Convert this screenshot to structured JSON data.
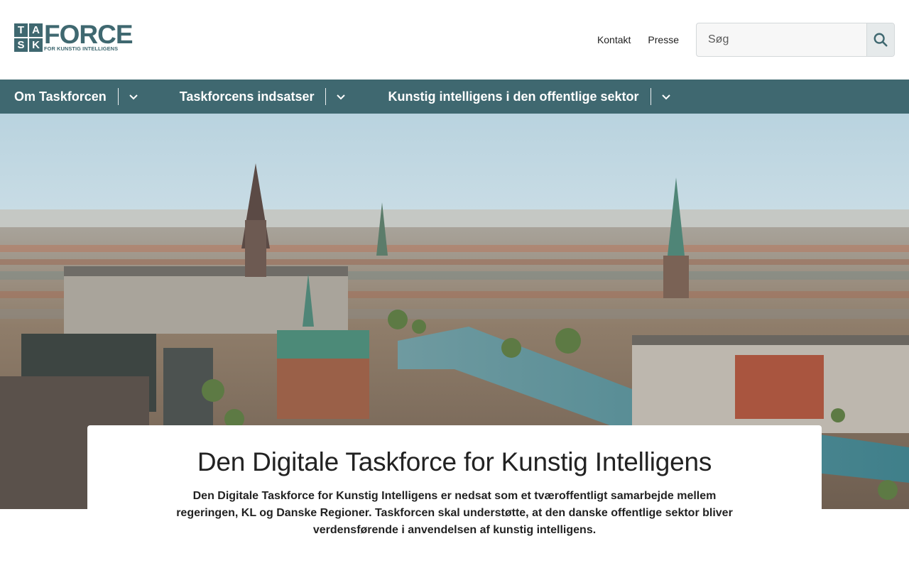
{
  "logo": {
    "letters": [
      "T",
      "A",
      "S",
      "K"
    ],
    "word": "FORCE",
    "subtitle": "FOR KUNSTIG INTELLIGENS",
    "color": "#3f6870"
  },
  "header": {
    "links": [
      "Kontakt",
      "Presse"
    ],
    "search": {
      "placeholder": "Søg",
      "icon": "search-icon"
    }
  },
  "nav": {
    "background": "#3f6870",
    "items": [
      {
        "label": "Om Taskforcen",
        "icon": "chevron-down-icon"
      },
      {
        "label": "Taskforcens indsatser",
        "icon": "chevron-down-icon"
      },
      {
        "label": "Kunstig intelligens i den offentlige sektor",
        "icon": "chevron-down-icon"
      }
    ]
  },
  "hero": {
    "image": "city-panorama-image"
  },
  "intro": {
    "title": "Den Digitale Taskforce for Kunstig Intelligens",
    "text": "Den Digitale Taskforce for Kunstig Intelligens er nedsat som et tværoffentligt samarbejde mellem regeringen, KL og Danske Regioner. Taskforcen skal understøtte, at den danske offentlige sektor bliver verdensførende i anvendelsen af kunstig intelligens."
  }
}
